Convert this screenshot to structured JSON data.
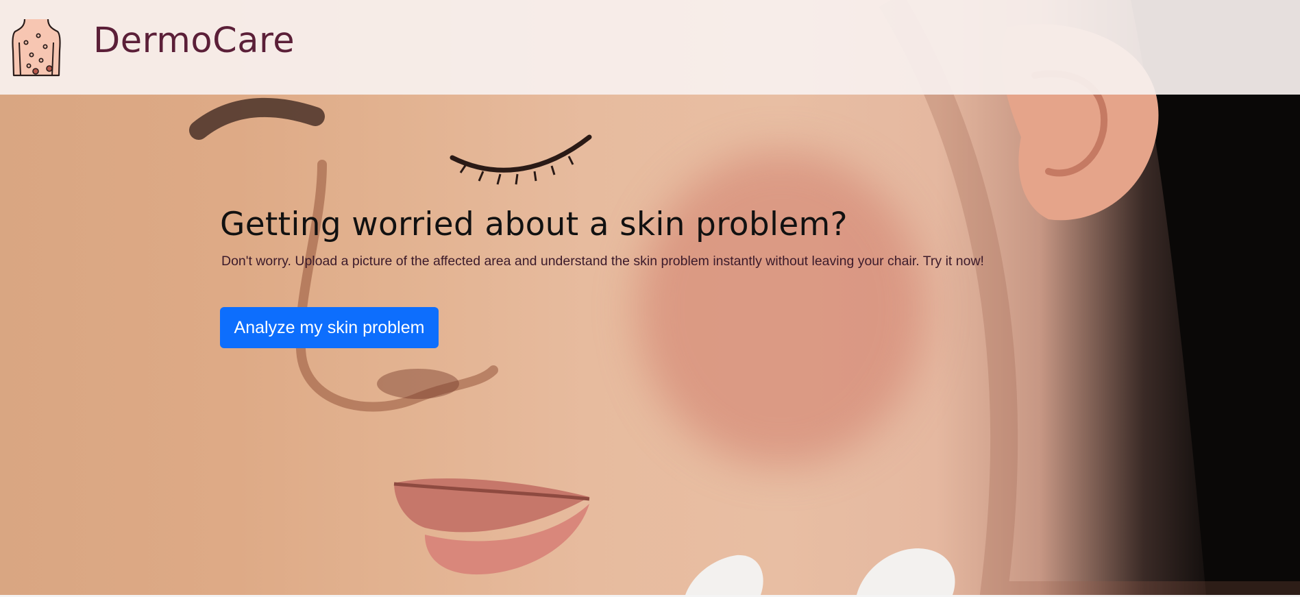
{
  "header": {
    "brand": "DermoCare",
    "logo_icon": "skin-body-icon"
  },
  "hero": {
    "title": "Getting worried about a skin problem?",
    "subtitle": "Don't worry. Upload a picture of the affected area and understand the skin problem instantly without leaving your chair. Try it now!",
    "cta_label": "Analyze my skin problem"
  },
  "colors": {
    "brand": "#5b1f38",
    "cta": "#0d6efd",
    "header_bg": "#f8f0ee"
  }
}
